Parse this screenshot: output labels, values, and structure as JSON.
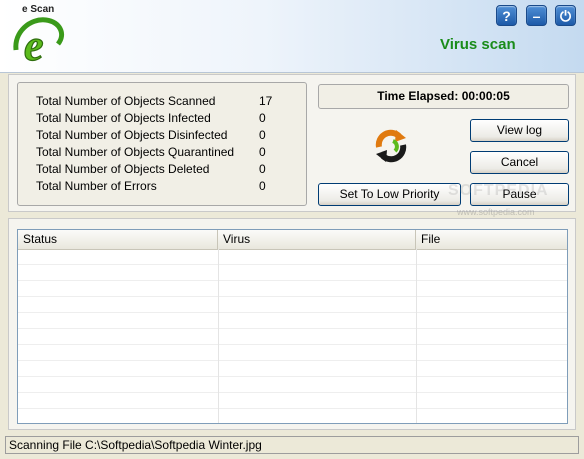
{
  "header": {
    "logo_text": "e Scan",
    "title": "Virus scan",
    "buttons": {
      "help": "?",
      "minimize": "–",
      "power": "⏻"
    }
  },
  "stats": [
    {
      "label": "Total Number of Objects Scanned",
      "value": "17"
    },
    {
      "label": "Total Number of Objects Infected",
      "value": "0"
    },
    {
      "label": "Total Number of Objects Disinfected",
      "value": "0"
    },
    {
      "label": "Total Number of Objects Quarantined",
      "value": "0"
    },
    {
      "label": "Total Number of Objects Deleted",
      "value": "0"
    },
    {
      "label": "Total Number of Errors",
      "value": "0"
    }
  ],
  "time_elapsed": "Time Elapsed: 00:00:05",
  "buttons": {
    "view_log": "View log",
    "cancel": "Cancel",
    "low_priority": "Set To Low Priority",
    "pause": "Pause"
  },
  "watermark": {
    "big": "SOFTPEDIA",
    "small": "www.softpedia.com"
  },
  "table": {
    "columns": [
      "Status",
      "Virus",
      "File"
    ],
    "rows": []
  },
  "status_text": "Scanning File C:\\Softpedia\\Softpedia Winter.jpg",
  "colors": {
    "title_green": "#1a8c1a",
    "button_blue": "#1d5aa8"
  }
}
